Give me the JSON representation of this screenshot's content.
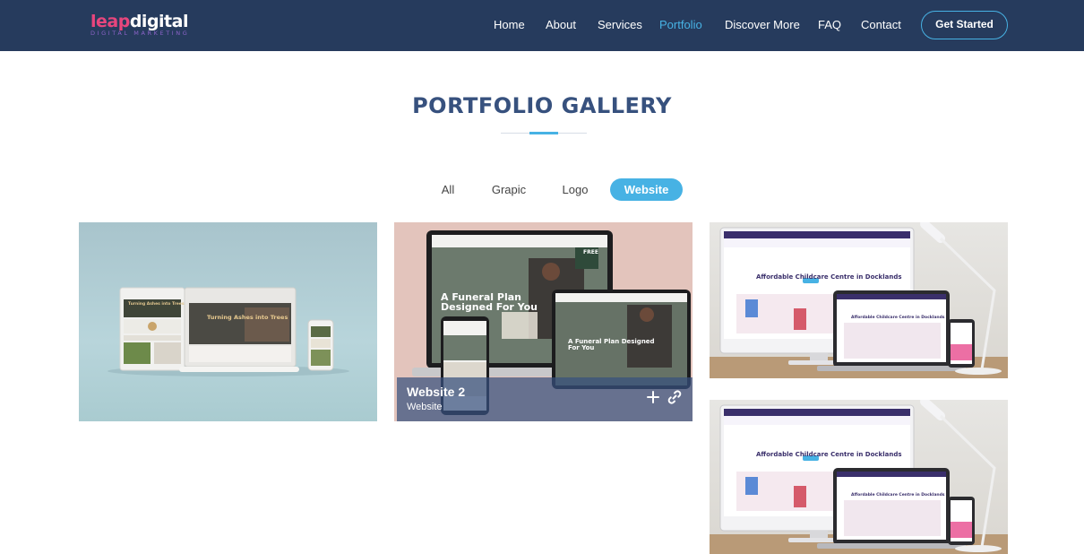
{
  "header": {
    "logo": {
      "main_a": "leap",
      "main_b": "digital",
      "sub": "DIGITAL MARKETING"
    },
    "nav": [
      {
        "label": "Home",
        "active": false
      },
      {
        "label": "About",
        "active": false
      },
      {
        "label": "Services",
        "active": false
      },
      {
        "label": "Portfolio",
        "active": true
      },
      {
        "label": "Discover More",
        "active": false
      },
      {
        "label": "FAQ",
        "active": false
      },
      {
        "label": "Contact",
        "active": false
      }
    ],
    "cta_label": "Get Started"
  },
  "section": {
    "title": "PORTFOLIO GALLERY"
  },
  "filters": [
    {
      "label": "All",
      "active": false
    },
    {
      "label": "Grapic",
      "active": false
    },
    {
      "label": "Logo",
      "active": false
    },
    {
      "label": "Website",
      "active": true
    }
  ],
  "portfolio": [
    {
      "image": "website-mockup-trees",
      "screen_heading": "Turning Ashes into Trees"
    },
    {
      "image": "website-mockup-funeral",
      "screen_heading": "A Funeral Plan Designed For You",
      "badge": "FREE",
      "overlay": {
        "title": "Website 2",
        "category": "Website"
      },
      "icons": [
        "plus-icon",
        "link-icon"
      ]
    },
    {
      "image": "website-mockup-childcare",
      "screen_heading": "Affordable Childcare Centre in Docklands"
    },
    {
      "image": "website-mockup-childcare",
      "screen_heading": "Affordable Childcare Centre in Docklands"
    }
  ],
  "colors": {
    "header_bg": "#263b5d",
    "accent": "#47b2e4",
    "title": "#37517e",
    "logo_pink": "#e8467d"
  }
}
